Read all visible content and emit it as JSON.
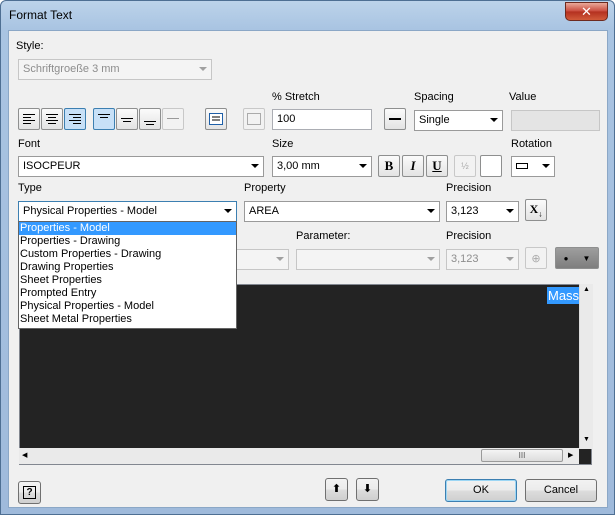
{
  "window": {
    "title": "Format Text",
    "close": "✕"
  },
  "style": {
    "label": "Style:",
    "value": "Schriftgroeße 3 mm"
  },
  "stretch": {
    "label": "% Stretch",
    "value": "100"
  },
  "spacing": {
    "label": "Spacing",
    "value": "Single"
  },
  "value_field": {
    "label": "Value",
    "value": ""
  },
  "font": {
    "label": "Font",
    "value": "ISOCPEUR"
  },
  "size": {
    "label": "Size",
    "value": "3,00 mm"
  },
  "format_buttons": {
    "bold": "B",
    "italic": "I",
    "underline": "U"
  },
  "rotation": {
    "label": "Rotation"
  },
  "type": {
    "label": "Type",
    "value": "Physical Properties - Model",
    "options": [
      "Properties - Model",
      "Properties - Drawing",
      "Custom Properties - Drawing",
      "Drawing Properties",
      "Sheet Properties",
      "Prompted Entry",
      "Physical Properties - Model",
      "Sheet Metal Properties"
    ],
    "selected_index": 0
  },
  "property": {
    "label": "Property",
    "value": "AREA"
  },
  "precision": {
    "label": "Precision",
    "value": "3,123"
  },
  "parameter": {
    "label": "Parameter:",
    "value": ""
  },
  "precision2": {
    "label": "Precision",
    "value": "3,123"
  },
  "preview": {
    "text": "Mass"
  },
  "footer": {
    "ok": "OK",
    "cancel": "Cancel",
    "help": "?"
  },
  "scroll": {
    "grip": "III"
  },
  "colors": {
    "selection": "#3399ff",
    "preview_bg": "#232323"
  }
}
